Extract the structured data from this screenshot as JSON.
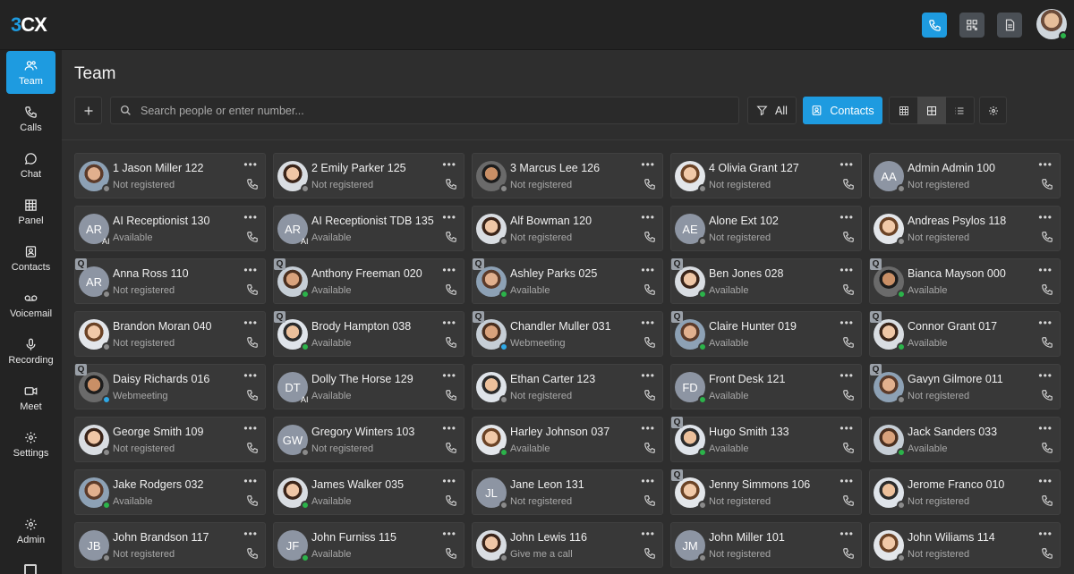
{
  "app": {
    "logo_prefix": "3",
    "logo_suffix": "CX"
  },
  "header": {
    "icons": [
      "phone-icon",
      "qr-code-icon",
      "document-icon"
    ]
  },
  "sidebar": {
    "items": [
      {
        "label": "Team",
        "icon": "team-icon",
        "active": true
      },
      {
        "label": "Calls",
        "icon": "phone-icon"
      },
      {
        "label": "Chat",
        "icon": "chat-icon"
      },
      {
        "label": "Panel",
        "icon": "grid-icon"
      },
      {
        "label": "Contacts",
        "icon": "contacts-icon"
      },
      {
        "label": "Voicemail",
        "icon": "voicemail-icon"
      },
      {
        "label": "Recording",
        "icon": "microphone-icon"
      },
      {
        "label": "Meet",
        "icon": "video-icon"
      },
      {
        "label": "Settings",
        "icon": "gear-icon"
      }
    ],
    "admin_label": "Admin"
  },
  "page": {
    "title": "Team"
  },
  "toolbar": {
    "search_placeholder": "Search people or enter number...",
    "filter_label": "All",
    "contacts_label": "Contacts"
  },
  "colors": {
    "accent": "#1e9be0",
    "available": "#2bb34a",
    "offline": "#8a8a8a",
    "webmeeting": "#2ea8e6"
  },
  "contacts": [
    {
      "name": "1 Jason Miller 122",
      "status": "Not registered",
      "avatar": "photo",
      "queue": false
    },
    {
      "name": "2 Emily Parker 125",
      "status": "Not registered",
      "avatar": "photo",
      "queue": false
    },
    {
      "name": "3 Marcus Lee 126",
      "status": "Not registered",
      "avatar": "photo",
      "queue": false
    },
    {
      "name": "4 Olivia Grant 127",
      "status": "Not registered",
      "avatar": "photo",
      "queue": false
    },
    {
      "name": "Admin Admin 100",
      "status": "Not registered",
      "avatar": "AA",
      "queue": false
    },
    {
      "name": "AI Receptionist 130",
      "status": "Available",
      "avatar": "AR",
      "ai": true,
      "queue": false
    },
    {
      "name": "AI Receptionist TDB 135",
      "status": "Available",
      "avatar": "AR",
      "ai": true,
      "queue": false
    },
    {
      "name": "Alf Bowman 120",
      "status": "Not registered",
      "avatar": "photo",
      "queue": false
    },
    {
      "name": "Alone Ext 102",
      "status": "Not registered",
      "avatar": "AE",
      "queue": false
    },
    {
      "name": "Andreas Psylos 118",
      "status": "Not registered",
      "avatar": "photo",
      "queue": false
    },
    {
      "name": "Anna Ross 110",
      "status": "Not registered",
      "avatar": "AR",
      "queue": true
    },
    {
      "name": "Anthony Freeman 020",
      "status": "Available",
      "avatar": "photo",
      "queue": true
    },
    {
      "name": "Ashley Parks 025",
      "status": "Available",
      "avatar": "photo",
      "queue": true
    },
    {
      "name": "Ben Jones 028",
      "status": "Available",
      "avatar": "photo",
      "queue": true
    },
    {
      "name": "Bianca Mayson 000",
      "status": "Available",
      "avatar": "photo",
      "queue": true
    },
    {
      "name": "Brandon Moran 040",
      "status": "Not registered",
      "avatar": "photo",
      "queue": false
    },
    {
      "name": "Brody Hampton 038",
      "status": "Available",
      "avatar": "photo",
      "queue": true
    },
    {
      "name": "Chandler Muller 031",
      "status": "Webmeeting",
      "avatar": "photo",
      "queue": true
    },
    {
      "name": "Claire Hunter 019",
      "status": "Available",
      "avatar": "photo",
      "queue": true
    },
    {
      "name": "Connor Grant 017",
      "status": "Available",
      "avatar": "photo",
      "queue": true
    },
    {
      "name": "Daisy Richards 016",
      "status": "Webmeeting",
      "avatar": "photo",
      "queue": true
    },
    {
      "name": "Dolly The Horse 129",
      "status": "Available",
      "avatar": "DT",
      "ai": true,
      "queue": false
    },
    {
      "name": "Ethan Carter 123",
      "status": "Not registered",
      "avatar": "photo",
      "queue": false
    },
    {
      "name": "Front Desk 121",
      "status": "Available",
      "avatar": "FD",
      "queue": false
    },
    {
      "name": "Gavyn Gilmore 011",
      "status": "Not registered",
      "avatar": "photo",
      "queue": true
    },
    {
      "name": "George Smith 109",
      "status": "Not registered",
      "avatar": "photo",
      "queue": false
    },
    {
      "name": "Gregory Winters 103",
      "status": "Not registered",
      "avatar": "GW",
      "queue": false
    },
    {
      "name": "Harley Johnson 037",
      "status": "Available",
      "avatar": "photo",
      "queue": false
    },
    {
      "name": "Hugo Smith 133",
      "status": "Available",
      "avatar": "photo",
      "queue": true
    },
    {
      "name": "Jack Sanders 033",
      "status": "Available",
      "avatar": "photo",
      "queue": false
    },
    {
      "name": "Jake Rodgers 032",
      "status": "Available",
      "avatar": "photo",
      "queue": false
    },
    {
      "name": "James Walker 035",
      "status": "Available",
      "avatar": "photo",
      "queue": false
    },
    {
      "name": "Jane Leon 131",
      "status": "Not registered",
      "avatar": "JL",
      "queue": false
    },
    {
      "name": "Jenny Simmons 106",
      "status": "Not registered",
      "avatar": "photo",
      "queue": true
    },
    {
      "name": "Jerome Franco 010",
      "status": "Not registered",
      "avatar": "photo",
      "queue": false
    },
    {
      "name": "John Brandson 117",
      "status": "Not registered",
      "avatar": "JB",
      "queue": false
    },
    {
      "name": "John Furniss 115",
      "status": "Available",
      "avatar": "JF",
      "queue": false
    },
    {
      "name": "John Lewis 116",
      "status": "Give me a call",
      "avatar": "photo",
      "queue": false
    },
    {
      "name": "John Miller 101",
      "status": "Not registered",
      "avatar": "JM",
      "queue": false
    },
    {
      "name": "John Wiliams 114",
      "status": "Not registered",
      "avatar": "photo",
      "queue": false
    }
  ]
}
